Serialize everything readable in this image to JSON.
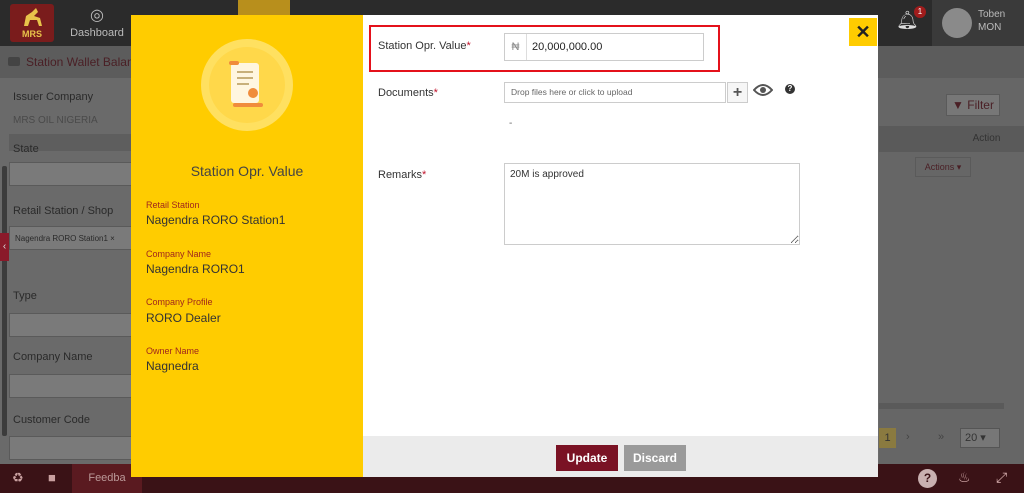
{
  "app": {
    "logo_text": "MRS",
    "nav_dashboard": "Dashboard",
    "notification_count": "1",
    "user_name_line1": "Toben",
    "user_name_line2": "MON",
    "page_title": "Station Wallet Balan",
    "colors": {
      "brand_maroon": "#7a1224",
      "accent_yellow": "#ffcc00",
      "required_red": "#c0142d",
      "highlight_red": "#e4111b"
    }
  },
  "filters": {
    "issuer_company_label": "Issuer Company",
    "issuer_company_value": "MRS OIL NIGERIA",
    "state_label": "State",
    "retail_station_label": "Retail Station / Shop",
    "retail_station_tag": "Nagendra RORO Station1 ×",
    "type_label": "Type",
    "company_name_label": "Company Name",
    "customer_code_label": "Customer Code",
    "filter_button": "Filter"
  },
  "table": {
    "action_header": "Action",
    "actions_button": "Actions ▾"
  },
  "pager": {
    "current_page": "1",
    "next": "›",
    "last": "»",
    "page_size": "20 ▾"
  },
  "footer": {
    "feedback_label": "Feedba"
  },
  "modal": {
    "left_title": "Station Opr. Value",
    "info": [
      {
        "label": "Retail Station",
        "value": "Nagendra RORO Station1"
      },
      {
        "label": "Company Name",
        "value": "Nagendra RORO1"
      },
      {
        "label": "Company Profile",
        "value": "RORO Dealer"
      },
      {
        "label": "Owner Name",
        "value": "Nagnedra"
      }
    ],
    "close_label": "✕",
    "fields": {
      "station_opr_value_label": "Station Opr. Value",
      "currency_symbol": "₦",
      "station_opr_value": "20,000,000.00",
      "documents_label": "Documents",
      "upload_placeholder": "Drop files here or click to upload",
      "documents_dash": "-",
      "remarks_label": "Remarks",
      "remarks_value": "20M is approved"
    },
    "buttons": {
      "update": "Update",
      "discard": "Discard"
    }
  }
}
